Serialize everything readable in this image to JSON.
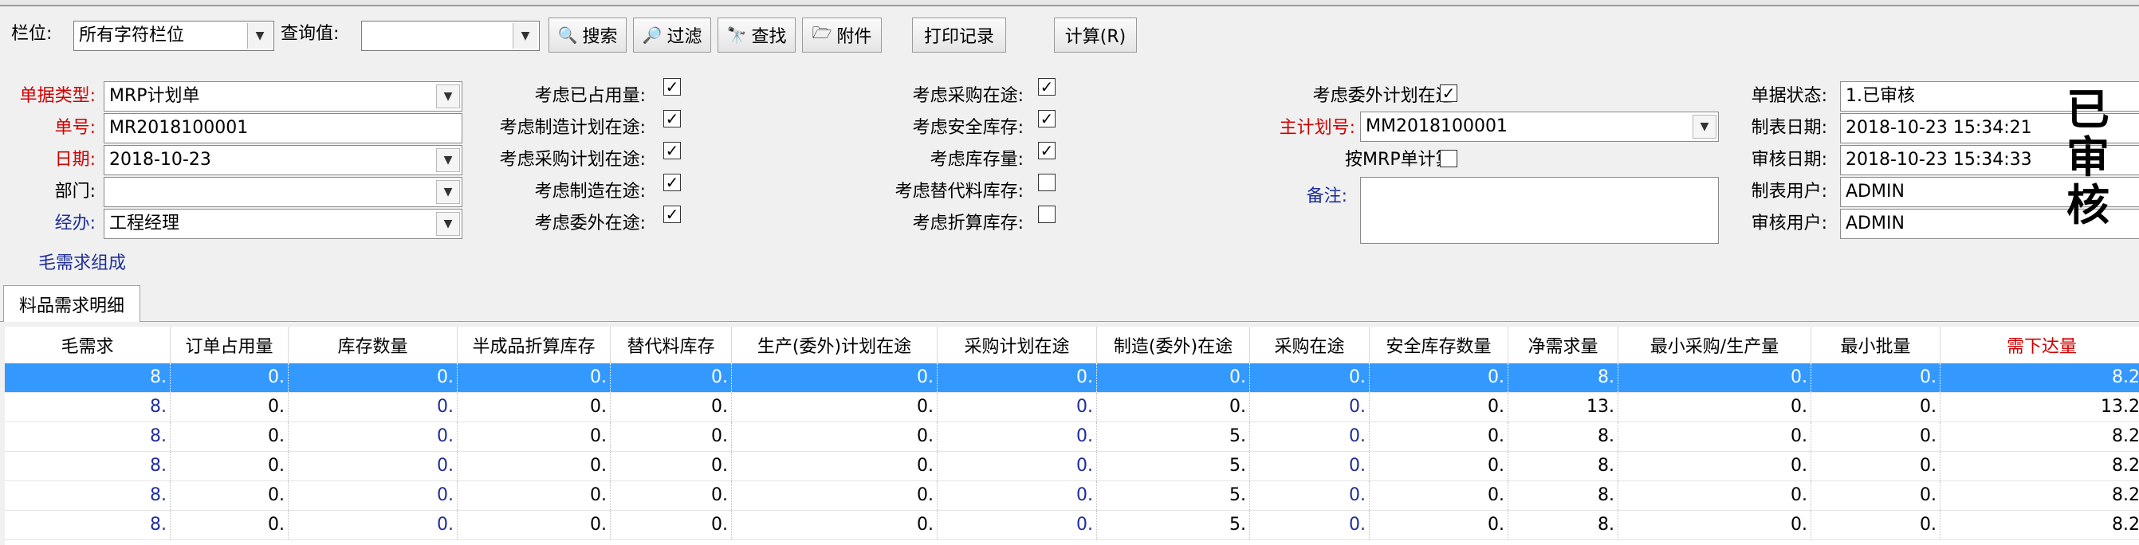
{
  "toolbar": {
    "field_label": "栏位:",
    "field_value": "所有字符栏位",
    "query_label": "查询值:",
    "query_value": "",
    "search_btn": "搜索",
    "filter_btn": "过滤",
    "find_btn": "查找",
    "attach_btn": "附件",
    "print_log_btn": "打印记录",
    "calc_btn": "计算(R)"
  },
  "form": {
    "doc_type_label": "单据类型:",
    "doc_type_value": "MRP计划单",
    "doc_no_label": "单号:",
    "doc_no_value": "MR2018100001",
    "date_label": "日期:",
    "date_value": "2018-10-23",
    "dept_label": "部门:",
    "dept_value": "",
    "handler_label": "经办:",
    "handler_value": "工程经理",
    "gross_link": "毛需求组成",
    "opt1": [
      {
        "label": "考虑已占用量:",
        "checked": true
      },
      {
        "label": "考虑制造计划在途:",
        "checked": true
      },
      {
        "label": "考虑采购计划在途:",
        "checked": true
      },
      {
        "label": "考虑制造在途:",
        "checked": true
      },
      {
        "label": "考虑委外在途:",
        "checked": true
      }
    ],
    "opt2": [
      {
        "label": "考虑采购在途:",
        "checked": true
      },
      {
        "label": "考虑安全库存:",
        "checked": true
      },
      {
        "label": "考虑库存量:",
        "checked": true
      },
      {
        "label": "考虑替代料库存:",
        "checked": false
      },
      {
        "label": "考虑折算库存:",
        "checked": false
      }
    ],
    "outsource_label": "考虑委外计划在途:",
    "outsource_checked": true,
    "master_plan_label": "主计划号:",
    "master_plan_value": "MM2018100001",
    "by_mrp_label": "按MRP单计算:",
    "by_mrp_checked": false,
    "remark_label": "备注:",
    "remark_value": "",
    "status_label": "单据状态:",
    "status_value": "1.已审核",
    "created_date_label": "制表日期:",
    "created_date_value": "2018-10-23 15:34:21",
    "audit_date_label": "审核日期:",
    "audit_date_value": "2018-10-23 15:34:33",
    "creator_label": "制表用户:",
    "creator_value": "ADMIN",
    "auditor_label": "审核用户:",
    "auditor_value": "ADMIN",
    "stamp_chars": [
      "已",
      "审",
      "核"
    ]
  },
  "tab": {
    "label": "料品需求明细"
  },
  "grid": {
    "columns": [
      "毛需求",
      "订单占用量",
      "库存数量",
      "半成品折算库存",
      "替代料库存",
      "生产(委外)计划在途",
      "采购计划在途",
      "制造(委外)在途",
      "采购在途",
      "安全库存数量",
      "净需求量",
      "最小采购/生产量",
      "最小批量",
      "需下达量"
    ],
    "rows": [
      [
        "8.",
        "0.",
        "0.",
        "0.",
        "0.",
        "0.",
        "0.",
        "0.",
        "0.",
        "0.",
        "8.",
        "0.",
        "0.",
        "8.2"
      ],
      [
        "8.",
        "0.",
        "0.",
        "0.",
        "0.",
        "0.",
        "0.",
        "0.",
        "0.",
        "0.",
        "13.",
        "0.",
        "0.",
        "13.2"
      ],
      [
        "8.",
        "0.",
        "0.",
        "0.",
        "0.",
        "0.",
        "0.",
        "5.",
        "0.",
        "0.",
        "8.",
        "0.",
        "0.",
        "8.2"
      ],
      [
        "8.",
        "0.",
        "0.",
        "0.",
        "0.",
        "0.",
        "0.",
        "5.",
        "0.",
        "0.",
        "8.",
        "0.",
        "0.",
        "8.2"
      ],
      [
        "8.",
        "0.",
        "0.",
        "0.",
        "0.",
        "0.",
        "0.",
        "5.",
        "0.",
        "0.",
        "8.",
        "0.",
        "0.",
        "8.2"
      ],
      [
        "8.",
        "0.",
        "0.",
        "0.",
        "0.",
        "0.",
        "0.",
        "5.",
        "0.",
        "0.",
        "8.",
        "0.",
        "0.",
        "8.2"
      ]
    ],
    "selected_row": 0
  },
  "colors": {
    "selection": "#3399ff",
    "required_label": "#d00000",
    "link": "#1f2f9a"
  }
}
